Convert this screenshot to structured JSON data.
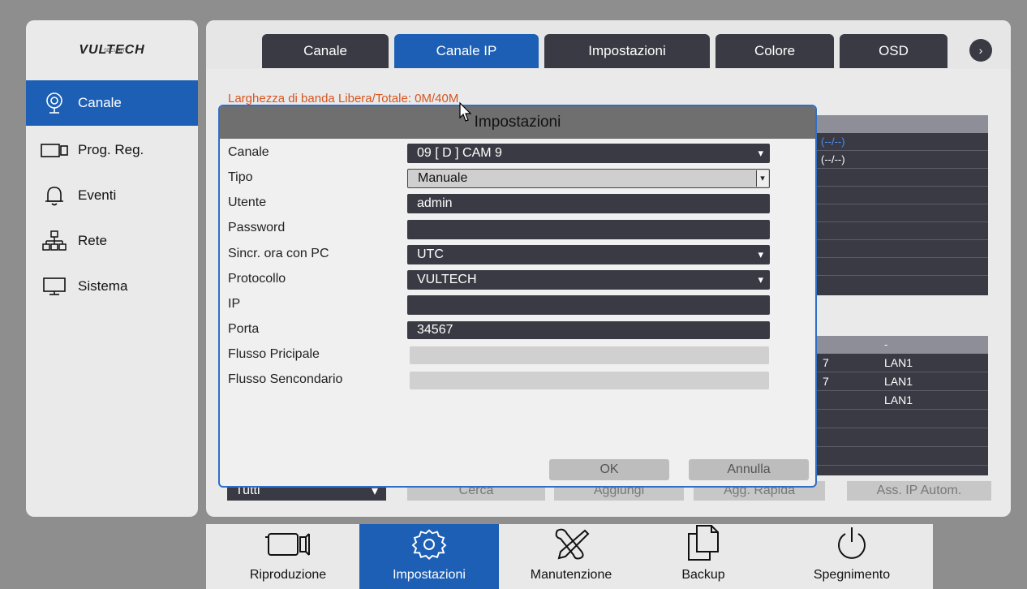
{
  "brand": {
    "logo": "VULTECH",
    "logo_sub": "SECURITY"
  },
  "tabs": [
    {
      "label": "Canale",
      "active": false
    },
    {
      "label": "Canale IP",
      "active": true
    },
    {
      "label": "Impostazioni",
      "active": false
    },
    {
      "label": "Colore",
      "active": false
    },
    {
      "label": "OSD",
      "active": false
    }
  ],
  "sidebar": {
    "items": [
      {
        "label": "Canale",
        "icon": "camera-icon",
        "active": true
      },
      {
        "label": "Prog. Reg.",
        "icon": "video-camera-icon",
        "active": false
      },
      {
        "label": "Eventi",
        "icon": "bell-icon",
        "active": false
      },
      {
        "label": "Rete",
        "icon": "network-icon",
        "active": false
      },
      {
        "label": "Sistema",
        "icon": "monitor-icon",
        "active": false
      }
    ]
  },
  "main": {
    "bandwidth": "Larghezza di banda Libera/Totale: 0M/40M",
    "table1": {
      "rows": [
        "(--/--)",
        "(--/--)"
      ]
    },
    "table2": {
      "header": "-",
      "rows": [
        {
          "c1": "7",
          "c2": "LAN1"
        },
        {
          "c1": "7",
          "c2": "LAN1"
        },
        {
          "c1": "",
          "c2": "LAN1"
        }
      ]
    },
    "filter_select": "Tutti",
    "buttons": {
      "search": "Cerca",
      "add": "Aggiungi",
      "quick_add": "Agg. Rapida",
      "auto_ip": "Ass. IP Autom."
    }
  },
  "dialog": {
    "title": "Impostazioni",
    "labels": {
      "channel": "Canale",
      "type": "Tipo",
      "user": "Utente",
      "password": "Password",
      "sync": "Sincr. ora con PC",
      "protocol": "Protocollo",
      "ip": "IP",
      "port": "Porta",
      "main_stream": "Flusso Pricipale",
      "sub_stream": "Flusso Sencondario"
    },
    "values": {
      "channel": "09 [ D ] CAM 9",
      "type": "Manuale",
      "user": "admin",
      "password": "",
      "sync": "UTC",
      "protocol": "VULTECH",
      "ip": "",
      "port": "34567",
      "main_stream": "",
      "sub_stream": ""
    },
    "ok_label": "OK",
    "cancel_label": "Annulla"
  },
  "bottom_nav": [
    {
      "label": "Riproduzione",
      "icon": "playback-camera-icon",
      "active": false
    },
    {
      "label": "Impostazioni",
      "icon": "settings-gear-icon",
      "active": true
    },
    {
      "label": "Manutenzione",
      "icon": "tools-icon",
      "active": false
    },
    {
      "label": "Backup",
      "icon": "copy-documents-icon",
      "active": false
    },
    {
      "label": "Spegnimento",
      "icon": "power-icon",
      "active": false
    }
  ],
  "colors": {
    "accent": "#1d5fb5",
    "dark_field": "#3a3a44",
    "warning_text": "#d8551f"
  }
}
